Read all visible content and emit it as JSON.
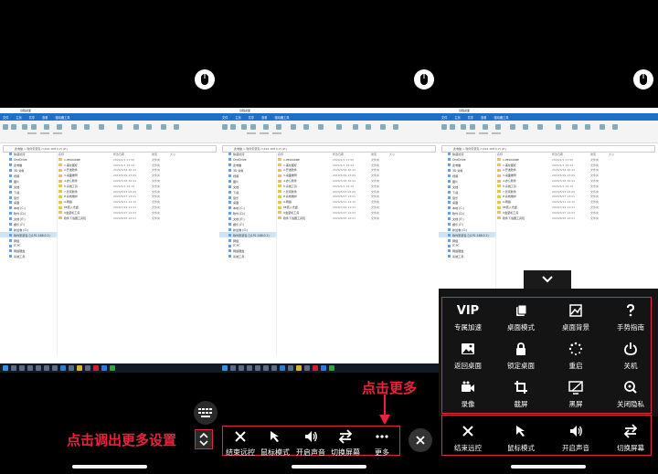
{
  "screen": {
    "panels": [
      {
        "title": "远程桌面",
        "tabs": [
          "文件",
          "主页",
          "共享",
          "查看",
          "驱动器工具"
        ],
        "address": "此电脑 > 软件安装包 (\\\\192.168.0.2) (Z:)",
        "nav": [
          "快速访问",
          "OneDrive",
          "此电脑",
          "3D 对象",
          "视频",
          "图片",
          "文档",
          "下载",
          "音乐",
          "桌面",
          "本地 (C:)",
          "软件 (D:)",
          "文档 (E:)",
          "娱乐 (F:)",
          "新加卷 (G:)",
          "软件安装包 (\\\\192.168.0.2)",
          "网络",
          "IT-PC",
          "网络硬盘",
          "系统工具"
        ],
        "columns": [
          "名称",
          "修改日期",
          "类型",
          "大小"
        ],
        "files": [
          {
            "name": "1.PEROWBE",
            "date": "2020/1/1 17:55",
            "type": "文件夹"
          },
          {
            "name": "1.美化图标",
            "date": "2020/1/1 15:23",
            "type": "文件夹"
          },
          {
            "name": "2.开发软件",
            "date": "2020/3/18 20:43",
            "type": "文件夹"
          },
          {
            "name": "3.桌面推荐",
            "date": "2019/5/29 13:09",
            "type": "文件夹"
          },
          {
            "name": "4.办公软件",
            "date": "2020/3/18 20:41",
            "type": "文件夹"
          },
          {
            "name": "5.系统工具",
            "date": "2020/2/1 19:12",
            "type": "文件夹"
          },
          {
            "name": "7.影音软件",
            "date": "2020/5/23 09:29",
            "type": "文件夹"
          },
          {
            "name": "8.系统维护",
            "date": "2020/5/27 13:51",
            "type": "文件夹"
          },
          {
            "name": "9.网络",
            "date": "2020/5/13 14:12",
            "type": "文件夹"
          },
          {
            "name": "PE装入光盘",
            "date": "2020/7/29 11:41",
            "type": "文件夹"
          },
          {
            "name": "U盘装机工具",
            "date": "2020/4/27 14:33",
            "type": "文件夹"
          },
          {
            "name": "软件下载器工具包",
            "date": "2020/8/25 10:21",
            "type": "文件夹"
          }
        ]
      }
    ]
  },
  "toolbar": {
    "items": [
      {
        "label": "结束远控",
        "icon": "close-icon"
      },
      {
        "label": "鼠标模式",
        "icon": "cursor-icon"
      },
      {
        "label": "开启声音",
        "icon": "speaker-icon"
      },
      {
        "label": "切换屏幕",
        "icon": "switch-icon"
      },
      {
        "label": "更多",
        "icon": "more-icon"
      }
    ]
  },
  "annotations": {
    "left": "点击调出更多设置",
    "right": "点击更多"
  },
  "more_menu": {
    "rows": [
      [
        {
          "label": "专属加速",
          "icon": "vip-icon",
          "text": "VIP"
        },
        {
          "label": "桌面模式",
          "icon": "desktop-mode-icon"
        },
        {
          "label": "桌面背景",
          "icon": "wallpaper-icon"
        },
        {
          "label": "手势指南",
          "icon": "help-icon"
        }
      ],
      [
        {
          "label": "返回桌面",
          "icon": "image-icon"
        },
        {
          "label": "锁定桌面",
          "icon": "lock-icon"
        },
        {
          "label": "重启",
          "icon": "restart-icon"
        },
        {
          "label": "关机",
          "icon": "power-icon"
        }
      ],
      [
        {
          "label": "录像",
          "icon": "video-icon"
        },
        {
          "label": "截屏",
          "icon": "crop-icon"
        },
        {
          "label": "黑屏",
          "icon": "black-screen-icon"
        },
        {
          "label": "关闭隐私",
          "icon": "privacy-icon"
        }
      ],
      [
        {
          "label": "结束远控",
          "icon": "close-icon"
        },
        {
          "label": "鼠标模式",
          "icon": "cursor-icon"
        },
        {
          "label": "开启声音",
          "icon": "speaker-icon"
        },
        {
          "label": "切换屏幕",
          "icon": "switch-icon"
        }
      ]
    ]
  },
  "colors": {
    "accent": "#e0283e",
    "ribbon": "#1e6fc9",
    "taskbar": "#121a28"
  }
}
